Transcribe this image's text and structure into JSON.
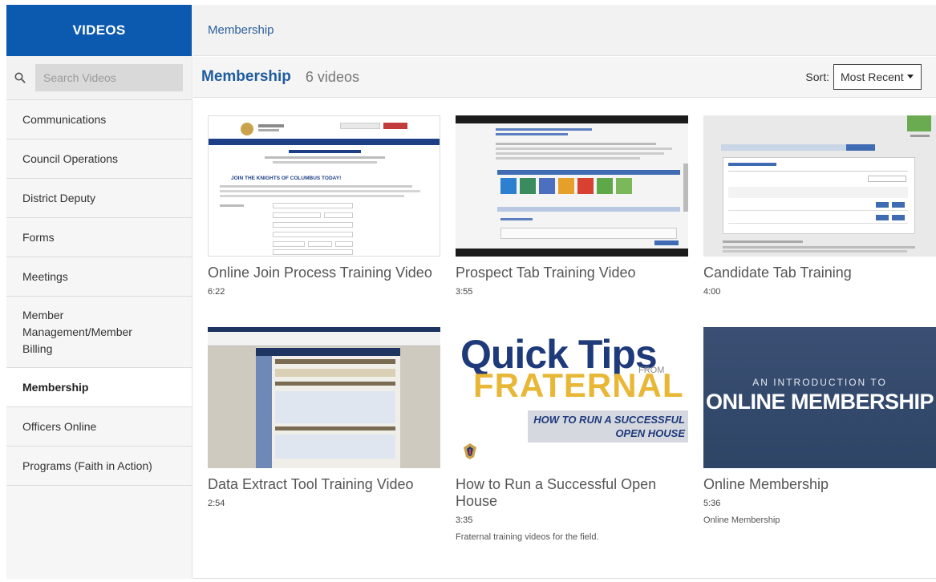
{
  "sidebar": {
    "title": "VIDEOS",
    "search_placeholder": "Search Videos",
    "items": [
      {
        "label": "Communications",
        "active": false
      },
      {
        "label": "Council Operations",
        "active": false
      },
      {
        "label": "District Deputy",
        "active": false
      },
      {
        "label": "Forms",
        "active": false
      },
      {
        "label": "Meetings",
        "active": false
      },
      {
        "label": "Member Management/Member Billing",
        "active": false
      },
      {
        "label": "Membership",
        "active": true
      },
      {
        "label": "Officers Online",
        "active": false
      },
      {
        "label": "Programs (Faith in Action)",
        "active": false
      }
    ]
  },
  "header": {
    "breadcrumb": "Membership",
    "title": "Membership",
    "count": "6 videos",
    "sort_label": "Sort:",
    "sort_value": "Most Recent"
  },
  "videos": [
    {
      "title": "Online Join Process Training Video",
      "duration": "6:22",
      "description": "",
      "thumb_text": "JOIN THE KNIGHTS OF COLUMBUS TODAY!"
    },
    {
      "title": "Prospect Tab Training Video",
      "duration": "3:55",
      "description": ""
    },
    {
      "title": "Candidate Tab Training",
      "duration": "4:00",
      "description": ""
    },
    {
      "title": "Data Extract Tool Training Video",
      "duration": "2:54",
      "description": ""
    },
    {
      "title": "How to Run a Successful Open House",
      "duration": "3:35",
      "description": "Fraternal training videos for the field.",
      "thumb_line1": "Quick Tips",
      "thumb_from": "FROM",
      "thumb_line2": "FRATERNAL",
      "thumb_banner1": "HOW TO RUN A SUCCESSFUL",
      "thumb_banner2": "OPEN HOUSE"
    },
    {
      "title": "Online Membership",
      "duration": "5:36",
      "description": "Online Membership",
      "thumb_small": "AN INTRODUCTION TO",
      "thumb_big": "ONLINE MEMBERSHIP"
    }
  ],
  "colors": {
    "brand": "#0c5ab0",
    "link": "#2b5f9a",
    "title": "#1f5c9e"
  }
}
